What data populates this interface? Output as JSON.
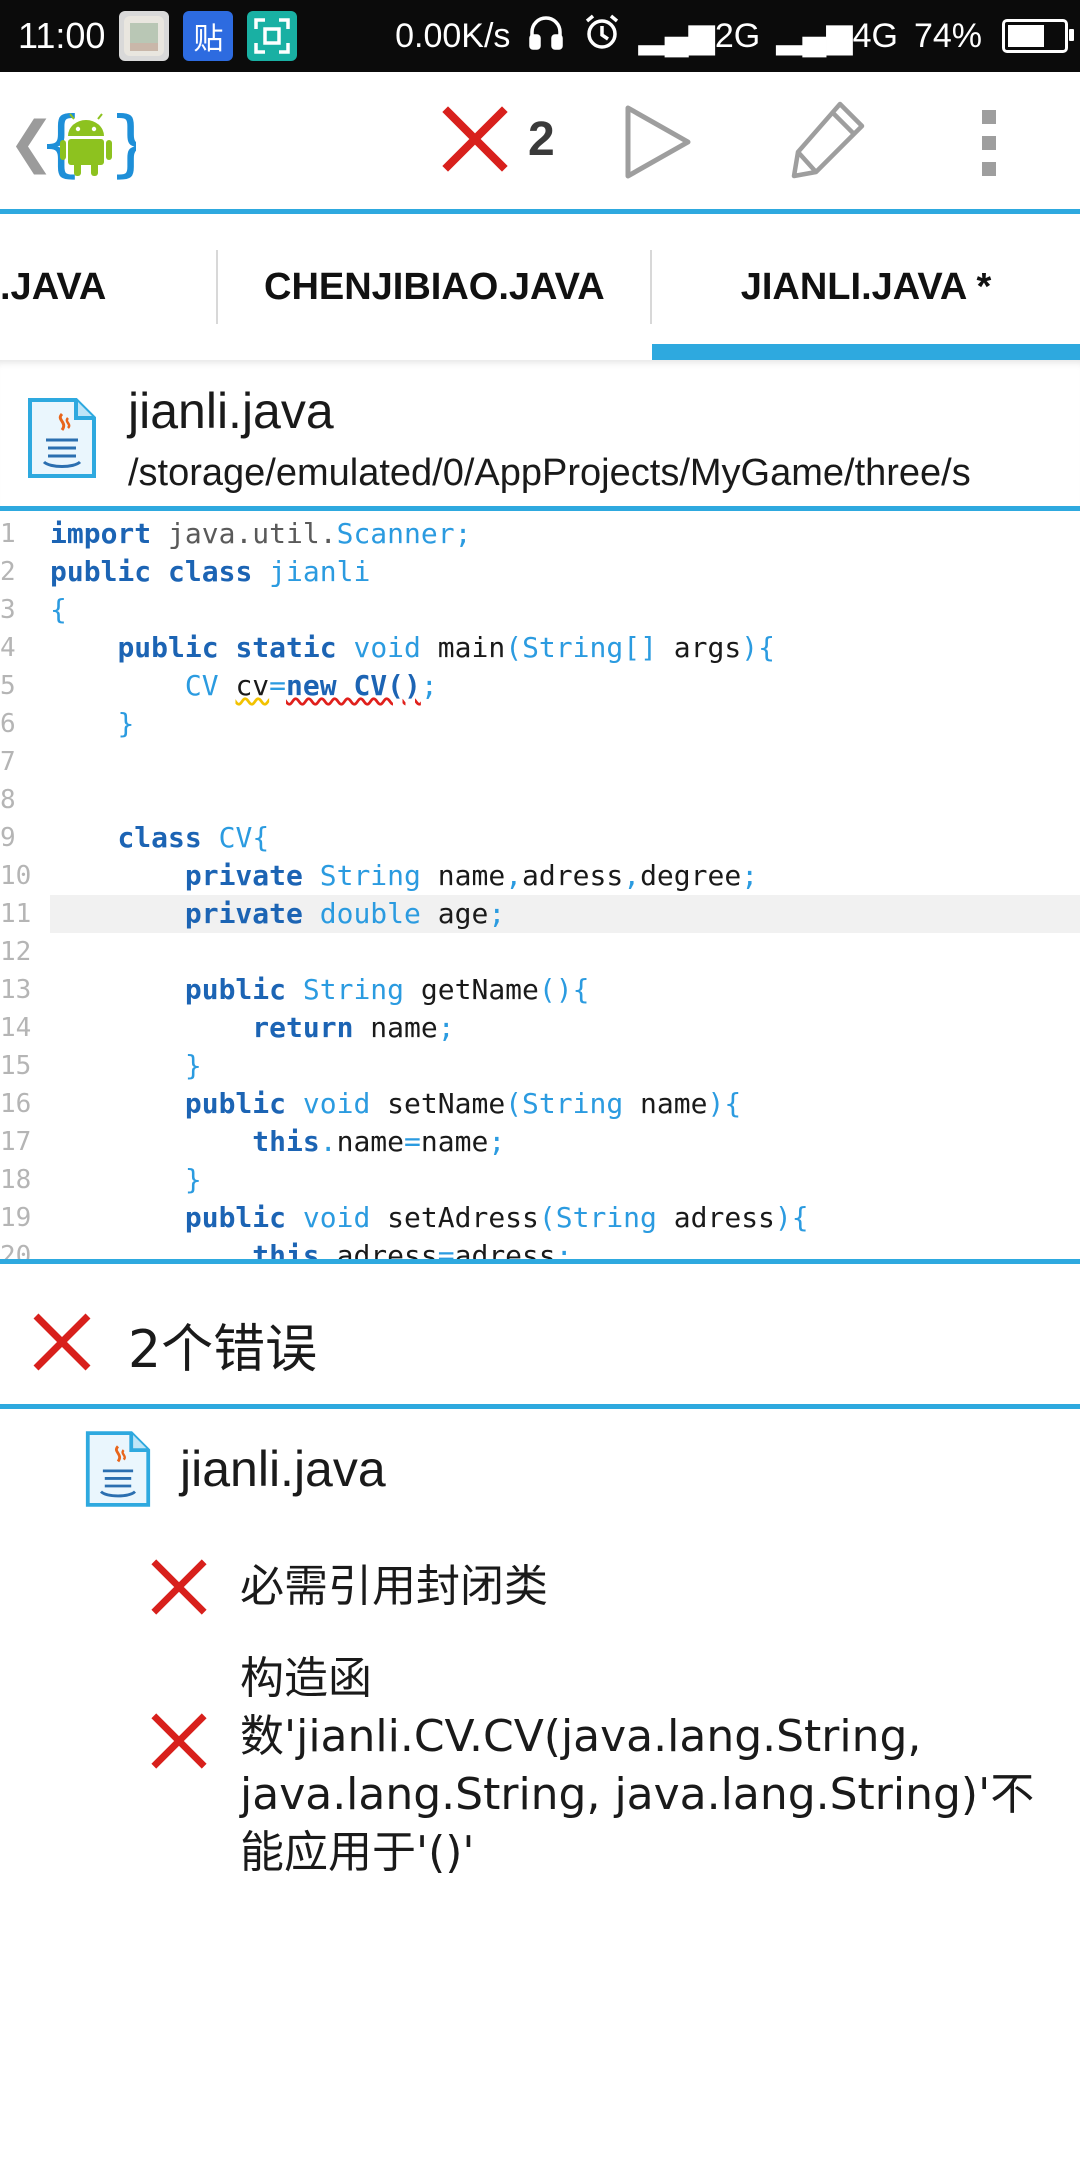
{
  "status_bar": {
    "time": "11:00",
    "app_icons": [
      "gallery-icon",
      "tieba-icon",
      "scan-icon"
    ],
    "tieba_label": "贴",
    "network_speed": "0.00K/s",
    "signal_2g": "2G",
    "signal_4g": "4G",
    "battery_percent": "74%",
    "battery_level": 0.74
  },
  "toolbar": {
    "error_count": "2"
  },
  "tabs": [
    {
      "label": ".JAVA"
    },
    {
      "label": "CHENJIBIAO.JAVA"
    },
    {
      "label": "JIANLI.JAVA *",
      "active": true
    }
  ],
  "file_header": {
    "name": "jianli.java",
    "path": "/storage/emulated/0/AppProjects/MyGame/three/s"
  },
  "code": {
    "active_line": 11,
    "lines": [
      [
        [
          "kw",
          "import"
        ],
        [
          "pk",
          " java.util."
        ],
        [
          "tp",
          "Scanner"
        ],
        [
          "op",
          ";"
        ]
      ],
      [
        [
          "kw",
          "public"
        ],
        [
          "tx",
          " "
        ],
        [
          "kw",
          "class"
        ],
        [
          "tx",
          " "
        ],
        [
          "tp",
          "jianli"
        ]
      ],
      [
        [
          "op",
          "{"
        ]
      ],
      [
        [
          "tx",
          "    "
        ],
        [
          "kw",
          "public"
        ],
        [
          "tx",
          " "
        ],
        [
          "kw",
          "static"
        ],
        [
          "tx",
          " "
        ],
        [
          "tp",
          "void"
        ],
        [
          "tx",
          " main"
        ],
        [
          "op",
          "("
        ],
        [
          "tp",
          "String[]"
        ],
        [
          "tx",
          " args"
        ],
        [
          "op",
          "){"
        ]
      ],
      [
        [
          "tx",
          "        "
        ],
        [
          "tp",
          "CV"
        ],
        [
          "tx",
          " "
        ],
        [
          "warn",
          "cv"
        ],
        [
          "op",
          "="
        ],
        [
          "err",
          "new CV()"
        ],
        [
          "op",
          ";"
        ]
      ],
      [
        [
          "tx",
          "    "
        ],
        [
          "op",
          "}"
        ]
      ],
      [],
      [],
      [
        [
          "tx",
          "    "
        ],
        [
          "kw",
          "class"
        ],
        [
          "tx",
          " "
        ],
        [
          "tp",
          "CV"
        ],
        [
          "op",
          "{"
        ]
      ],
      [
        [
          "tx",
          "        "
        ],
        [
          "kw",
          "private"
        ],
        [
          "tx",
          " "
        ],
        [
          "tp",
          "String"
        ],
        [
          "tx",
          " name"
        ],
        [
          "op",
          ","
        ],
        [
          "tx",
          "adress"
        ],
        [
          "op",
          ","
        ],
        [
          "tx",
          "degree"
        ],
        [
          "op",
          ";"
        ]
      ],
      [
        [
          "tx",
          "        "
        ],
        [
          "kw",
          "private"
        ],
        [
          "tx",
          " "
        ],
        [
          "tp",
          "double"
        ],
        [
          "tx",
          " age"
        ],
        [
          "op",
          ";"
        ]
      ],
      [],
      [
        [
          "tx",
          "        "
        ],
        [
          "kw",
          "public"
        ],
        [
          "tx",
          " "
        ],
        [
          "tp",
          "String"
        ],
        [
          "tx",
          " getName"
        ],
        [
          "op",
          "(){"
        ]
      ],
      [
        [
          "tx",
          "            "
        ],
        [
          "kw",
          "return"
        ],
        [
          "tx",
          " name"
        ],
        [
          "op",
          ";"
        ]
      ],
      [
        [
          "tx",
          "        "
        ],
        [
          "op",
          "}"
        ]
      ],
      [
        [
          "tx",
          "        "
        ],
        [
          "kw",
          "public"
        ],
        [
          "tx",
          " "
        ],
        [
          "tp",
          "void"
        ],
        [
          "tx",
          " setName"
        ],
        [
          "op",
          "("
        ],
        [
          "tp",
          "String"
        ],
        [
          "tx",
          " name"
        ],
        [
          "op",
          "){"
        ]
      ],
      [
        [
          "tx",
          "            "
        ],
        [
          "kw",
          "this"
        ],
        [
          "op",
          "."
        ],
        [
          "tx",
          "name"
        ],
        [
          "op",
          "="
        ],
        [
          "tx",
          "name"
        ],
        [
          "op",
          ";"
        ]
      ],
      [
        [
          "tx",
          "        "
        ],
        [
          "op",
          "}"
        ]
      ],
      [
        [
          "tx",
          "        "
        ],
        [
          "kw",
          "public"
        ],
        [
          "tx",
          " "
        ],
        [
          "tp",
          "void"
        ],
        [
          "tx",
          " setAdress"
        ],
        [
          "op",
          "("
        ],
        [
          "tp",
          "String"
        ],
        [
          "tx",
          " adress"
        ],
        [
          "op",
          "){"
        ]
      ],
      [
        [
          "tx",
          "            "
        ],
        [
          "kw",
          "this"
        ],
        [
          "op",
          "."
        ],
        [
          "tx",
          "adress"
        ],
        [
          "op",
          "="
        ],
        [
          "tx",
          "adress"
        ],
        [
          "op",
          ";"
        ]
      ]
    ]
  },
  "errors_panel": {
    "title": "2个错误",
    "file_name": "jianli.java",
    "messages": [
      "必需引用封闭类",
      "构造函数'jianli.CV.CV(java.lang.String, java.lang.String, java.lang.String)'不能应用于'()'"
    ]
  },
  "colors": {
    "accent": "#2ea9df",
    "error_red": "#d8201c",
    "android_green": "#8dc21f",
    "keyword": "#1c64b4",
    "type": "#2b9be0"
  }
}
